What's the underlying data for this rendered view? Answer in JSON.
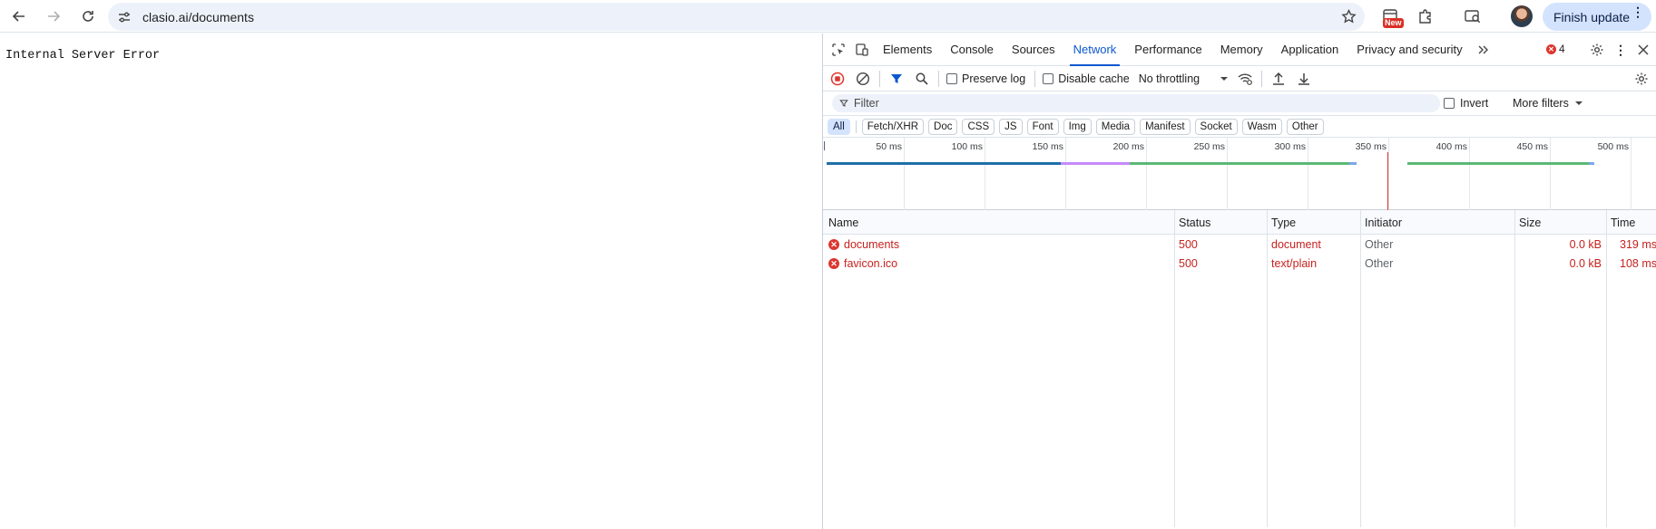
{
  "browser": {
    "url": "clasio.ai/documents",
    "new_badge": "New",
    "finish_update": "Finish update"
  },
  "page": {
    "error_text": "Internal Server Error"
  },
  "devtools": {
    "tabs": [
      "Elements",
      "Console",
      "Sources",
      "Network",
      "Performance",
      "Memory",
      "Application",
      "Privacy and security"
    ],
    "active_tab": "Network",
    "error_count": "4",
    "toolbar": {
      "preserve_log": "Preserve log",
      "disable_cache": "Disable cache",
      "throttling": "No throttling"
    },
    "filter": {
      "placeholder": "Filter",
      "invert": "Invert",
      "more_filters": "More filters"
    },
    "type_filters": [
      "All",
      "Fetch/XHR",
      "Doc",
      "CSS",
      "JS",
      "Font",
      "Img",
      "Media",
      "Manifest",
      "Socket",
      "Wasm",
      "Other"
    ],
    "timeline_ticks": [
      "50 ms",
      "100 ms",
      "150 ms",
      "200 ms",
      "250 ms",
      "300 ms",
      "350 ms",
      "400 ms",
      "450 ms",
      "500 ms"
    ],
    "columns": [
      "Name",
      "Status",
      "Type",
      "Initiator",
      "Size",
      "Time"
    ],
    "requests": [
      {
        "name": "documents",
        "status": "500",
        "type": "document",
        "initiator": "Other",
        "size": "0.0 kB",
        "time": "319 ms"
      },
      {
        "name": "favicon.ico",
        "status": "500",
        "type": "text/plain",
        "initiator": "Other",
        "size": "0.0 kB",
        "time": "108 ms"
      }
    ],
    "colors": {
      "accent": "#0b57d0",
      "error": "#dc362e"
    }
  }
}
